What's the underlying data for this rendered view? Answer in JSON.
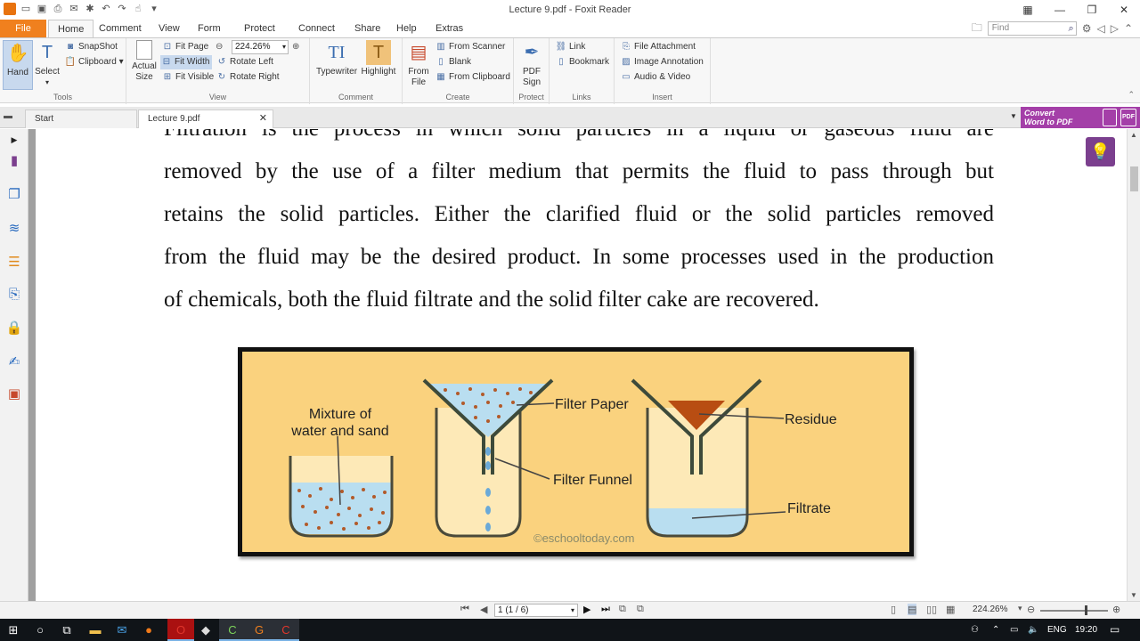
{
  "window": {
    "title": "Lecture 9.pdf - Foxit Reader"
  },
  "ribbon_tabs": [
    "File",
    "Home",
    "Comment",
    "View",
    "Form",
    "Protect",
    "Connect",
    "Share",
    "Help",
    "Extras"
  ],
  "search": {
    "placeholder": "Find"
  },
  "ribbon": {
    "tools": {
      "hand": "Hand",
      "select": "Select",
      "snapshot": "SnapShot",
      "clipboard": "Clipboard",
      "label": "Tools"
    },
    "view": {
      "actual_size": "Actual Size",
      "fit_page": "Fit Page",
      "fit_width": "Fit Width",
      "fit_visible": "Fit Visible",
      "zoom": "224.26%",
      "rotate_left": "Rotate Left",
      "rotate_right": "Rotate Right",
      "label": "View"
    },
    "comment": {
      "typewriter": "Typewriter",
      "highlight": "Highlight",
      "label": "Comment"
    },
    "create": {
      "from_file": "From File",
      "from_scanner": "From Scanner",
      "blank": "Blank",
      "from_clipboard": "From Clipboard",
      "label": "Create"
    },
    "protect": {
      "pdf_sign": "PDF Sign",
      "label": "Protect"
    },
    "links": {
      "link": "Link",
      "bookmark": "Bookmark",
      "label": "Links"
    },
    "insert": {
      "file_attachment": "File Attachment",
      "image_annotation": "Image Annotation",
      "audio_video": "Audio & Video",
      "label": "Insert"
    }
  },
  "doc_tabs": [
    {
      "label": "Start"
    },
    {
      "label": "Lecture 9.pdf"
    }
  ],
  "convert_banner": {
    "line1": "Convert",
    "line2": "Word to PDF",
    "pdf_badge": "PDF"
  },
  "document": {
    "lines": [
      "Filtration is  the process in which solid particles in a liquid or gaseous fluid are",
      "removed by the use of a filter medium that permits the fluid to pass through but",
      "retains the solid particles. Either the clarified fluid or the solid particles removed",
      "from the fluid may be the desired product. In some processes used in the production",
      "of chemicals, both the fluid filtrate and the solid filter cake are recovered."
    ],
    "figure": {
      "mixture_line1": "Mixture of",
      "mixture_line2": "water and sand",
      "filter_paper": "Filter Paper",
      "filter_funnel": "Filter Funnel",
      "residue": "Residue",
      "filtrate": "Filtrate",
      "credit": "©eschooltoday.com"
    }
  },
  "statusbar": {
    "page": "1 (1 / 6)",
    "zoom": "224.26%"
  },
  "taskbar": {
    "lang": "ENG",
    "time": "19:20"
  }
}
